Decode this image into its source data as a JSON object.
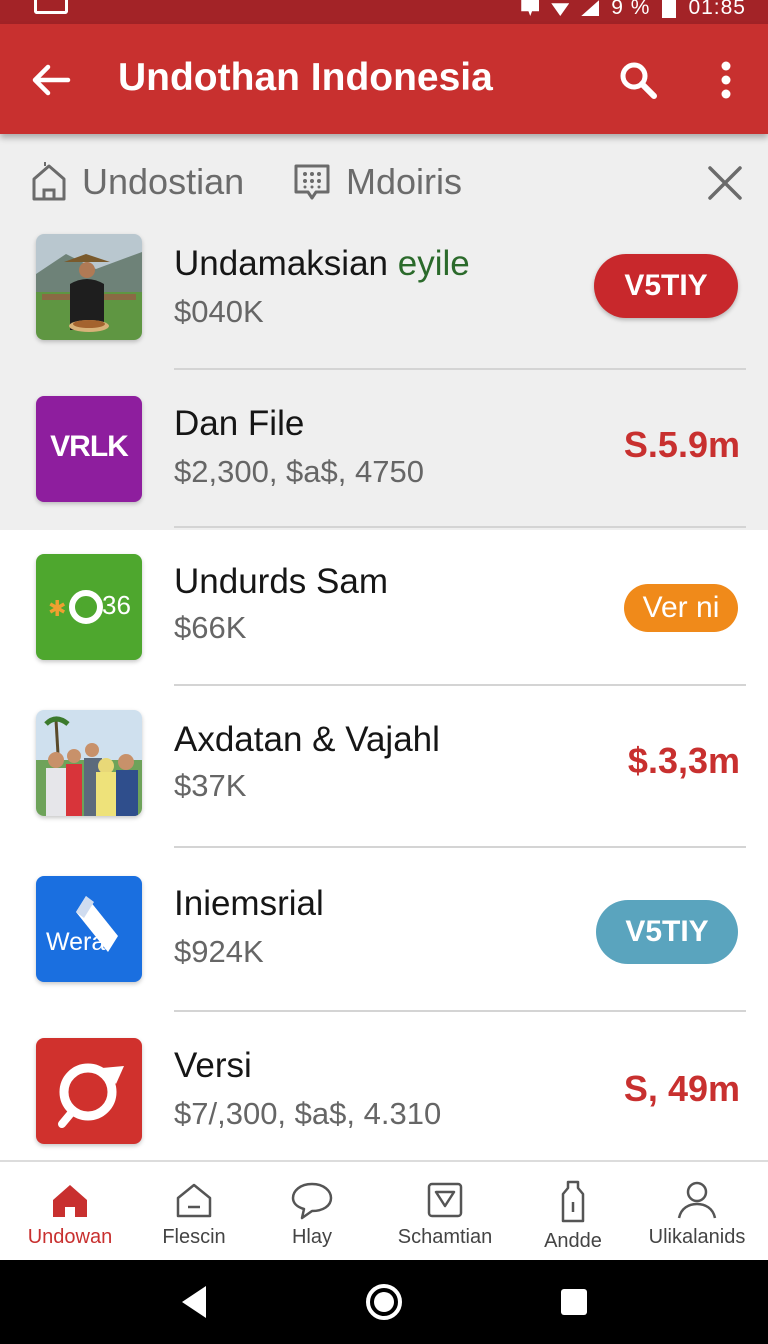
{
  "status_bar": {
    "battery_text": "9 %",
    "time": "01:85"
  },
  "app_bar": {
    "title": "Undothan Indonesia"
  },
  "filters": [
    {
      "label": "Undostian",
      "icon": "home-outline-icon"
    },
    {
      "label": "Mdoiris",
      "icon": "keypad-box-icon"
    }
  ],
  "items": [
    {
      "title": "Undamaksian",
      "title_accent": "eyile",
      "subtitle": "$040K",
      "action": "V5TIY",
      "action_style": "red-pill"
    },
    {
      "title": "Dan File",
      "subtitle": "$2,300, $a$, 4750",
      "price": "S.5.9m",
      "thumb_text": "VRLK"
    },
    {
      "title": "Undurds Sam",
      "subtitle": "$66K",
      "action": "Ver ni",
      "action_style": "orange-pill",
      "thumb_text": "36"
    },
    {
      "title": "Axdatan & Vajahl",
      "subtitle": "$37K",
      "price": "$.3,3m"
    },
    {
      "title": "Iniemsrial",
      "subtitle": "$924K",
      "action": "V5TIY",
      "action_style": "teal-pill",
      "thumb_text": "Wera"
    },
    {
      "title": "Versi",
      "subtitle": "$7/,300, $a$, 4.310",
      "price": "S, 49m"
    }
  ],
  "bottom_nav": [
    {
      "label": "Undowan",
      "icon": "home-icon",
      "active": true
    },
    {
      "label": "Flescin",
      "icon": "house-outline-icon",
      "active": false
    },
    {
      "label": "Hlay",
      "icon": "chat-bubble-icon",
      "active": false
    },
    {
      "label": "Schamtian",
      "icon": "download-box-icon",
      "active": false
    },
    {
      "label": "Andde",
      "icon": "bottle-icon",
      "active": false
    },
    {
      "label": "Ulikalanids",
      "icon": "person-icon",
      "active": false
    }
  ],
  "colors": {
    "primary": "#c8302f",
    "status_bar": "#a32327",
    "orange": "#f08a1a",
    "teal": "#5aa4be",
    "green_accent": "#2b6a2b"
  }
}
